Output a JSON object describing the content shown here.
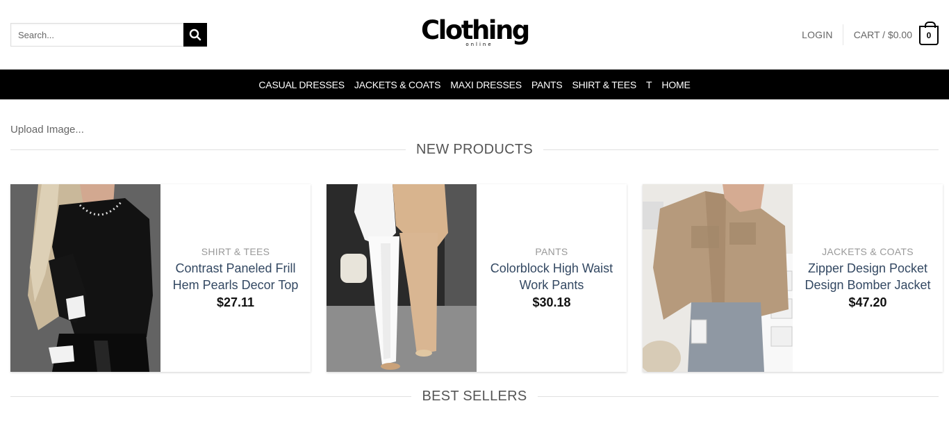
{
  "header": {
    "search_placeholder": "Search...",
    "logo_main": "Clothing",
    "logo_sub": "online",
    "login_label": "LOGIN",
    "cart_label": "CART / $0.00",
    "cart_count": "0"
  },
  "nav": {
    "items": [
      "CASUAL DRESSES",
      "JACKETS & COATS",
      "MAXI DRESSES",
      "PANTS",
      "SHIRT & TEES",
      "T",
      "HOME"
    ]
  },
  "upload_label": "Upload Image...",
  "sections": {
    "new_products": "NEW PRODUCTS",
    "best_sellers": "BEST SELLERS"
  },
  "products": [
    {
      "category": "SHIRT & TEES",
      "name": "Contrast Paneled Frill Hem Pearls Decor Top",
      "price": "$27.11"
    },
    {
      "category": "PANTS",
      "name": "Colorblock High Waist Work Pants",
      "price": "$30.18"
    },
    {
      "category": "JACKETS & COATS",
      "name": "Zipper Design Pocket Design Bomber Jacket",
      "price": "$47.20"
    }
  ],
  "icons": {
    "search": "search-icon",
    "cart": "cart-icon"
  },
  "colors": {
    "nav_bg": "#000000",
    "product_name": "#334862",
    "category": "#999999"
  }
}
